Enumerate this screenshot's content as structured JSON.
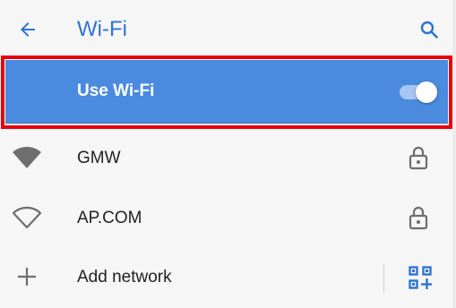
{
  "toolbar": {
    "back_icon": "arrow-left-icon",
    "title": "Wi-Fi",
    "search_icon": "search-icon"
  },
  "master_switch": {
    "label": "Use Wi-Fi",
    "state": "on",
    "bar_color": "#4a8bdf",
    "highlight_color": "#e8000c"
  },
  "networks": [
    {
      "name": "GMW",
      "signal_icon": "wifi-filled-icon",
      "secured": true,
      "lock_icon": "lock-icon"
    },
    {
      "name": "AP.COM",
      "signal_icon": "wifi-outline-icon",
      "secured": true,
      "lock_icon": "lock-icon"
    }
  ],
  "add_network": {
    "icon": "plus-icon",
    "label": "Add network",
    "qr_icon": "qr-code-scan-icon"
  },
  "colors": {
    "accent": "#2f74d0",
    "icon_gray": "#6e6e6e",
    "background": "#f6f6f6"
  }
}
